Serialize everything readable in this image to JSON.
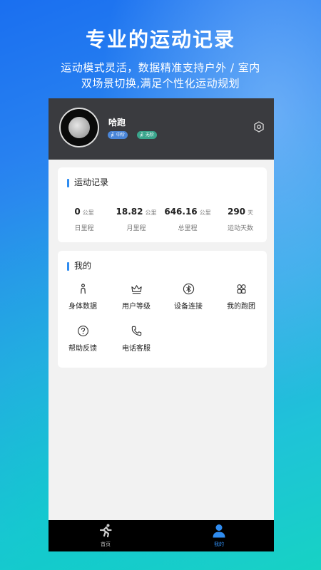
{
  "promo": {
    "headline": "专业的运动记录",
    "subline_1": "运动模式灵活，数据精准支持户外 / 室内",
    "subline_2": "双场景切换,满足个性化运动规划"
  },
  "profile": {
    "username": "哈跑",
    "badges": [
      {
        "icon": "runner-icon",
        "label": "中阶",
        "color": "#4a86d8"
      },
      {
        "icon": "runner-icon",
        "label": "无阶",
        "color": "#3aa58c"
      }
    ],
    "settings_icon": "settings-hexagon-icon"
  },
  "records": {
    "title": "运动记录",
    "stats": [
      {
        "value": "0",
        "unit": "公里",
        "label": "日里程"
      },
      {
        "value": "18.82",
        "unit": "公里",
        "label": "月里程"
      },
      {
        "value": "646.16",
        "unit": "公里",
        "label": "总里程"
      },
      {
        "value": "290",
        "unit": "天",
        "label": "运动天数"
      }
    ]
  },
  "mine": {
    "title": "我的",
    "items": [
      {
        "icon": "body-data-icon",
        "label": "身体数据"
      },
      {
        "icon": "crown-icon",
        "label": "用户等级"
      },
      {
        "icon": "bluetooth-icon",
        "label": "设备连接"
      },
      {
        "icon": "group-icon",
        "label": "我的跑团"
      },
      {
        "icon": "help-icon",
        "label": "帮助反馈"
      },
      {
        "icon": "phone-icon",
        "label": "电话客服"
      }
    ]
  },
  "tabbar": {
    "tabs": [
      {
        "icon": "runner-icon",
        "label": "首页",
        "active": false
      },
      {
        "icon": "person-icon",
        "label": "我的",
        "active": true
      }
    ],
    "active_color": "#2f8cf0"
  }
}
